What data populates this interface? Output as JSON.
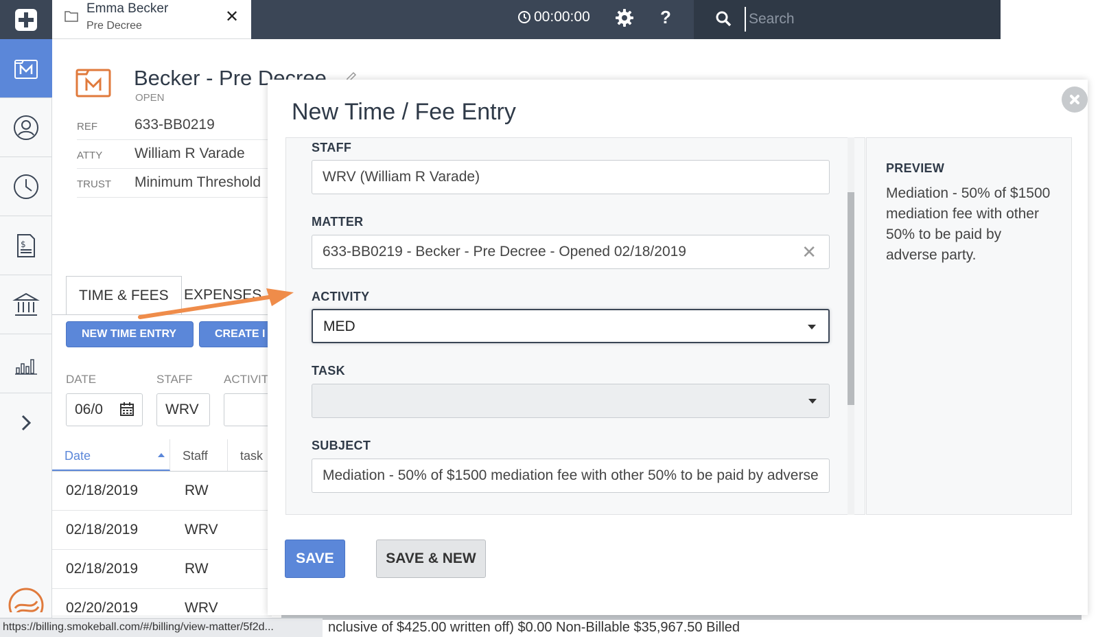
{
  "topbar": {
    "matter_tab_name": "Emma Becker",
    "matter_tab_sub": "Pre Decree",
    "close_glyph": "✕",
    "timer": "00:00:00",
    "help_glyph": "?",
    "search_placeholder": "Search"
  },
  "matter": {
    "title": "Becker - Pre Decree",
    "status": "OPEN",
    "details": [
      {
        "label": "REF",
        "value": "633-BB0219"
      },
      {
        "label": "ATTY",
        "value": "William R Varade"
      },
      {
        "label": "TRUST",
        "value": "Minimum Threshold"
      }
    ]
  },
  "tabs": [
    {
      "label": "TIME & FEES"
    },
    {
      "label": "EXPENSES"
    }
  ],
  "actions": {
    "new_time_entry": "NEW TIME ENTRY",
    "create": "CREATE I"
  },
  "filters": {
    "date_label": "DATE",
    "date_value": "06/0",
    "staff_label": "STAFF",
    "staff_value": "WRV",
    "activity_label": "ACTIVIT"
  },
  "table": {
    "headers": [
      "Date",
      "Staff",
      "task"
    ],
    "rows": [
      {
        "date": "02/18/2019",
        "staff": "RW"
      },
      {
        "date": "02/18/2019",
        "staff": "WRV"
      },
      {
        "date": "02/18/2019",
        "staff": "RW"
      },
      {
        "date": "02/20/2019",
        "staff": "WRV"
      }
    ]
  },
  "status_bar": {
    "url": "https://billing.smokeball.com/#/billing/view-matter/5f2d...",
    "summary": "nclusive of $425.00 written off)  $0.00 Non-Billable  $35,967.50 Billed"
  },
  "modal": {
    "title": "New Time / Fee Entry",
    "staff_label": "STAFF",
    "staff_value": "WRV (William R Varade)",
    "matter_label": "MATTER",
    "matter_value": "633-BB0219 - Becker - Pre Decree - Opened 02/18/2019",
    "clear_glyph": "✕",
    "activity_label": "ACTIVITY",
    "activity_value": "MED",
    "task_label": "TASK",
    "task_value": "",
    "subject_label": "SUBJECT",
    "subject_value": "Mediation - 50% of $1500 mediation fee with other 50% to be paid by adverse",
    "preview_label": "PREVIEW",
    "preview_text": "Mediation - 50% of $1500 mediation fee with other 50% to be paid by adverse party.",
    "save_label": "SAVE",
    "save_new_label": "SAVE & NEW"
  },
  "colors": {
    "accent": "#5b87d9",
    "topbar": "#3b4656",
    "annotation_arrow": "#ef8c4a"
  },
  "icons": [
    "plus-icon",
    "matter-icon",
    "contact-icon",
    "clock-icon",
    "invoice-icon",
    "bank-icon",
    "chart-icon",
    "chevron-right-icon",
    "folder-icon",
    "gear-icon",
    "search-icon",
    "calendar-icon",
    "pencil-icon"
  ]
}
